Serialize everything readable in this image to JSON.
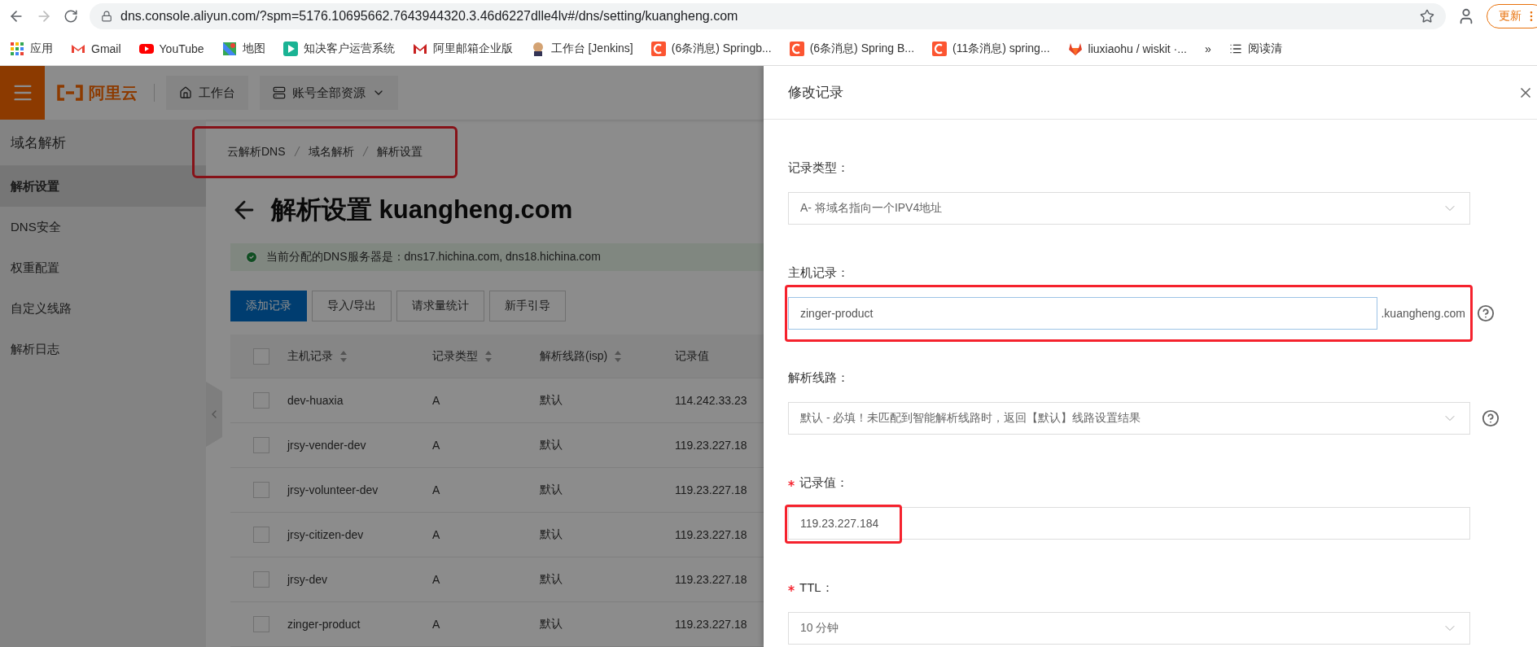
{
  "browser": {
    "url": "dns.console.aliyun.com/?spm=5176.10695662.7643944320.3.46d6227dlle4lv#/dns/setting/kuangheng.com",
    "update_button": "更新",
    "bookmarks": [
      {
        "label": "应用",
        "kind": "apps"
      },
      {
        "label": "Gmail",
        "kind": "gmail"
      },
      {
        "label": "YouTube",
        "kind": "youtube"
      },
      {
        "label": "地图",
        "kind": "maps"
      },
      {
        "label": "知决客户运营系统",
        "kind": "play"
      },
      {
        "label": "阿里邮箱企业版",
        "kind": "mail"
      },
      {
        "label": "工作台 [Jenkins]",
        "kind": "jenkins"
      },
      {
        "label": "(6条消息) Springb...",
        "kind": "csdn"
      },
      {
        "label": "(6条消息) Spring B...",
        "kind": "csdn"
      },
      {
        "label": "(11条消息) spring...",
        "kind": "csdn"
      },
      {
        "label": "liuxiaohu / wiskit ·...",
        "kind": "gitlab"
      }
    ],
    "more": "»",
    "reading_list": "阅读清"
  },
  "header": {
    "logo": "阿里云",
    "workbench": "工作台",
    "resources": "账号全部资源"
  },
  "sidebar": {
    "title": "域名解析",
    "items": [
      {
        "label": "解析设置",
        "selected": true
      },
      {
        "label": "DNS安全",
        "selected": false
      },
      {
        "label": "权重配置",
        "selected": false
      },
      {
        "label": "自定义线路",
        "selected": false
      },
      {
        "label": "解析日志",
        "selected": false
      }
    ]
  },
  "breadcrumb": {
    "highlighted": true,
    "items": [
      "云解析DNS",
      "域名解析",
      "解析设置"
    ]
  },
  "page_title": "解析设置 kuangheng.com",
  "alert": "当前分配的DNS服务器是：dns17.hichina.com, dns18.hichina.com",
  "toolbar": [
    {
      "label": "添加记录",
      "kind": "primary"
    },
    {
      "label": "导入/导出",
      "kind": "default"
    },
    {
      "label": "请求量统计",
      "kind": "default"
    },
    {
      "label": "新手引导",
      "kind": "default"
    }
  ],
  "table": {
    "header_checked": false,
    "columns": [
      {
        "label": "主机记录",
        "sortable": true
      },
      {
        "label": "记录类型",
        "sortable": true
      },
      {
        "label": "解析线路(isp)",
        "sortable": true
      },
      {
        "label": "记录值",
        "sortable": false
      }
    ],
    "rows": [
      {
        "checked": false,
        "cells": [
          "dev-huaxia",
          "A",
          "默认",
          "114.242.33.23"
        ]
      },
      {
        "checked": false,
        "cells": [
          "jrsy-vender-dev",
          "A",
          "默认",
          "119.23.227.18"
        ]
      },
      {
        "checked": false,
        "cells": [
          "jrsy-volunteer-dev",
          "A",
          "默认",
          "119.23.227.18"
        ]
      },
      {
        "checked": false,
        "cells": [
          "jrsy-citizen-dev",
          "A",
          "默认",
          "119.23.227.18"
        ]
      },
      {
        "checked": false,
        "cells": [
          "jrsy-dev",
          "A",
          "默认",
          "119.23.227.18"
        ]
      },
      {
        "checked": false,
        "cells": [
          "zinger-product",
          "A",
          "默认",
          "119.23.227.18"
        ]
      }
    ]
  },
  "drawer": {
    "title": "修改记录",
    "fields": [
      {
        "kind": "select",
        "label": "记录类型：",
        "required": false,
        "value": "A- 将域名指向一个IPV4地址",
        "help": false,
        "highlighted": false
      },
      {
        "kind": "input",
        "label": "主机记录：",
        "required": false,
        "value": "zinger-product",
        "suffix": ".kuangheng.com",
        "help": true,
        "highlighted": true
      },
      {
        "kind": "select",
        "label": "解析线路：",
        "required": false,
        "value": "默认 - 必填！未匹配到智能解析线路时，返回【默认】线路设置结果",
        "help": true,
        "highlighted": false
      },
      {
        "kind": "input",
        "label": "记录值：",
        "required": true,
        "value": "119.23.227.184",
        "help": false,
        "highlighted": true
      },
      {
        "kind": "select",
        "label": "TTL：",
        "required": true,
        "value": "10 分钟",
        "help": false,
        "highlighted": false
      }
    ]
  }
}
